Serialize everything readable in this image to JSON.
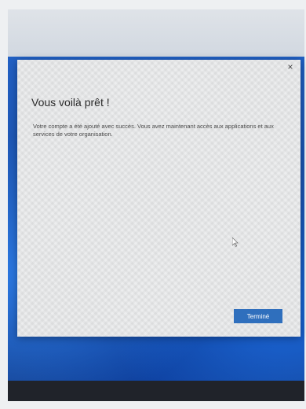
{
  "dialog": {
    "close_glyph": "×",
    "title": "Vous voilà prêt !",
    "message": "Votre compte a été ajouté avec succès. Vous avez maintenant accès aux applications et aux services de votre organisation.",
    "done_label": "Terminé"
  },
  "colors": {
    "accent": "#2f6fbd",
    "wallpaper": "#1f4f9c",
    "dialog_bg": "#ecedee"
  },
  "icons": {
    "close": "close-icon",
    "pointer": "mouse-pointer-icon"
  }
}
